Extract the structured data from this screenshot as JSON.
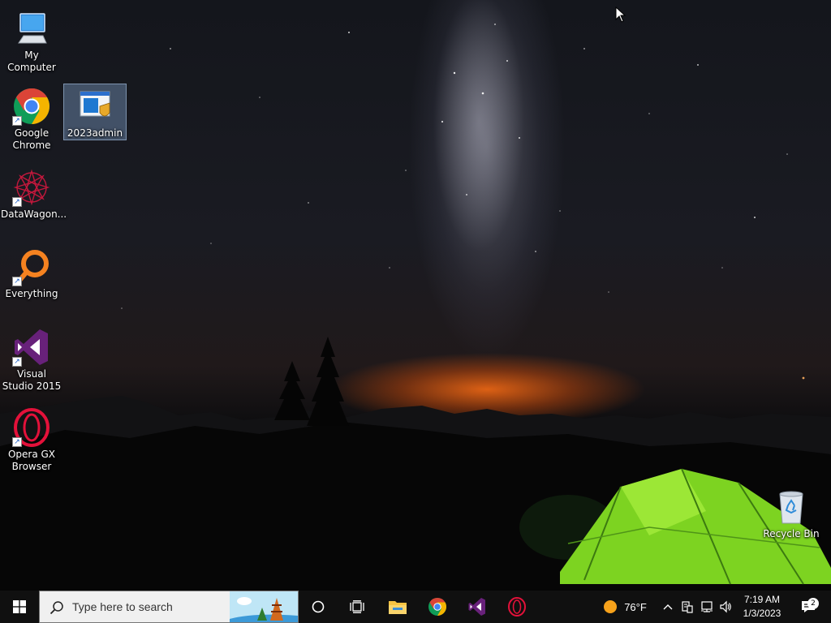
{
  "desktop": {
    "icons": [
      {
        "label": "My Computer"
      },
      {
        "label": "Google Chrome"
      },
      {
        "label": "2023admin"
      },
      {
        "label": "DataWagon..."
      },
      {
        "label": "Everything"
      },
      {
        "label": "Visual Studio 2015"
      },
      {
        "label": "Opera GX Browser"
      },
      {
        "label": "Recycle Bin"
      }
    ],
    "selected_icon": "2023admin"
  },
  "taskbar": {
    "search_placeholder": "Type here to search",
    "pinned": [
      {
        "icon": "cortana-circle-icon"
      },
      {
        "icon": "task-view-icon"
      },
      {
        "icon": "file-explorer-icon"
      },
      {
        "icon": "chrome-icon"
      },
      {
        "icon": "visual-studio-icon"
      },
      {
        "icon": "opera-gx-icon"
      }
    ],
    "weather": {
      "temp": "76°F",
      "icon": "sun-icon"
    },
    "clock": {
      "time": "7:19 AM",
      "date": "1/3/2023"
    },
    "notifications": {
      "count": "2"
    }
  },
  "colors": {
    "taskbar": "#101010",
    "chrome_red": "#DB4437",
    "chrome_green": "#0F9D58",
    "chrome_yellow": "#F4B400",
    "chrome_blue": "#4285F4",
    "vs_purple": "#68217A",
    "opera_red": "#E3113A",
    "everything_orange": "#F58220",
    "tent_green": "#7DD321"
  }
}
